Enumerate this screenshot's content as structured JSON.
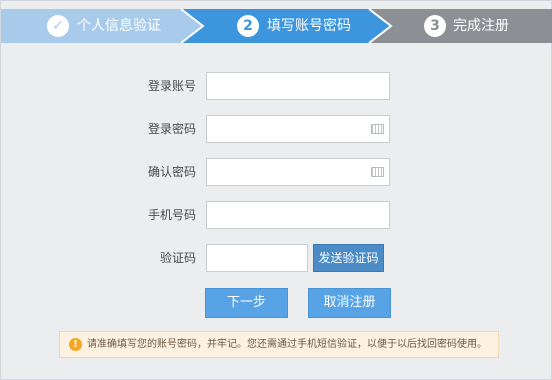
{
  "steps": [
    {
      "number": "✓",
      "label": "个人信息验证",
      "state": "done"
    },
    {
      "number": "2",
      "label": "填写账号密码",
      "state": "active"
    },
    {
      "number": "3",
      "label": "完成注册",
      "state": "pending"
    }
  ],
  "colors": {
    "step_done": "#a8cbec",
    "step_active": "#3c95dd",
    "step_pending": "#8c8f93",
    "button": "#57a3e6",
    "sms_button": "#4b8bc6",
    "notice_bg": "#fdf1e2",
    "notice_icon": "#f5a623"
  },
  "form": {
    "account_label": "登录账号",
    "account_value": "",
    "password_label": "登录密码",
    "password_value": "",
    "confirm_label": "确认密码",
    "confirm_value": "",
    "phone_label": "手机号码",
    "phone_value": "",
    "code_label": "验证码",
    "code_value": "",
    "send_code_button": "发送验证码"
  },
  "actions": {
    "next": "下一步",
    "cancel": "取消注册"
  },
  "notice": {
    "icon": "!",
    "text": "请准确填写您的账号密码，并牢记。您还需通过手机短信验证，以便于以后找回密码使用。"
  },
  "icons": {
    "step_done": "check-icon",
    "password_keyboard": "keyboard-icon",
    "notice": "warning-icon"
  }
}
